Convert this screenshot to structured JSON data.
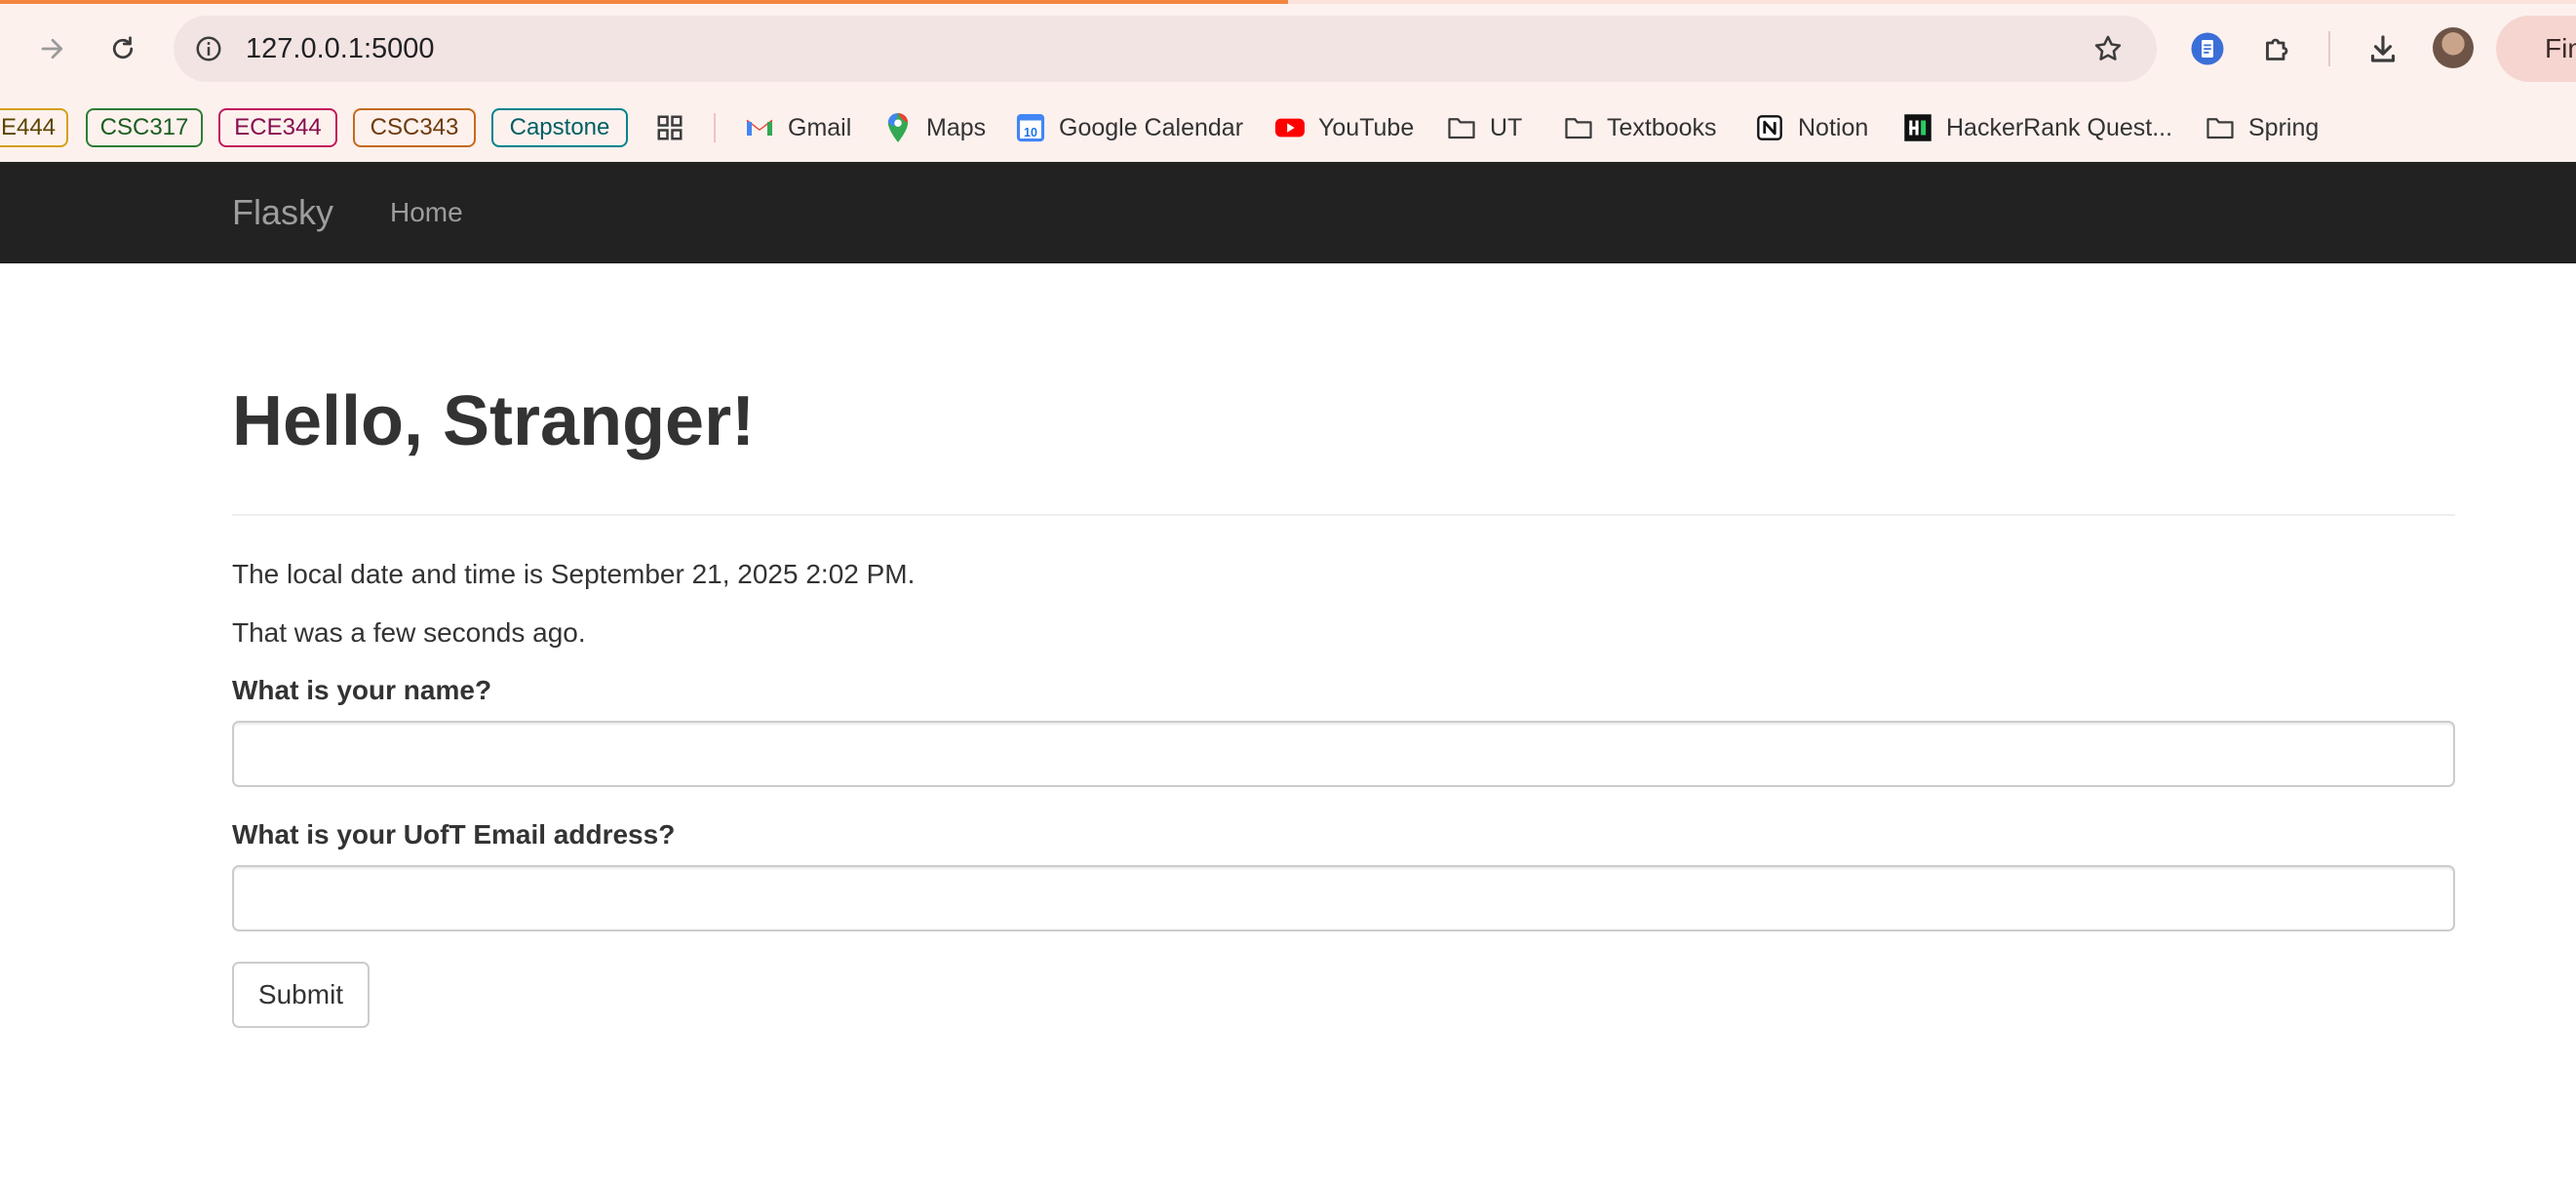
{
  "browser": {
    "url": "127.0.0.1:5000",
    "finish_label": "Finish",
    "load_progress": 0.5,
    "accent": "#f2863e",
    "tab_groups": [
      {
        "label": "E444",
        "color": "#d4a017"
      },
      {
        "label": "CSC317",
        "color": "#2e7d32"
      },
      {
        "label": "ECE344",
        "color": "#c2185b"
      },
      {
        "label": "CSC343",
        "color": "#c56a1a"
      },
      {
        "label": "Capstone",
        "color": "#00838f"
      }
    ],
    "bookmarks": [
      {
        "label": "Gmail",
        "icon": "gmail-icon"
      },
      {
        "label": "Maps",
        "icon": "maps-pin-icon"
      },
      {
        "label": "Google Calendar",
        "icon": "calendar-icon"
      },
      {
        "label": "YouTube",
        "icon": "youtube-icon"
      },
      {
        "label": "UT",
        "icon": "folder-icon"
      },
      {
        "label": "Textbooks",
        "icon": "folder-icon"
      },
      {
        "label": "Notion",
        "icon": "notion-icon"
      },
      {
        "label": "HackerRank Quest...",
        "icon": "hackerrank-icon"
      },
      {
        "label": "Spring",
        "icon": "folder-icon"
      }
    ]
  },
  "navbar": {
    "brand": "Flasky",
    "links": [
      {
        "label": "Home"
      }
    ]
  },
  "page": {
    "title": "Hello, Stranger!",
    "datetime_text": "The local date and time is September 21, 2025 2:02 PM.",
    "relative_text": "That was a few seconds ago.",
    "form": {
      "name_label": "What is your name?",
      "name_value": "",
      "email_label": "What is your UofT Email address?",
      "email_value": "",
      "submit_label": "Submit"
    }
  }
}
